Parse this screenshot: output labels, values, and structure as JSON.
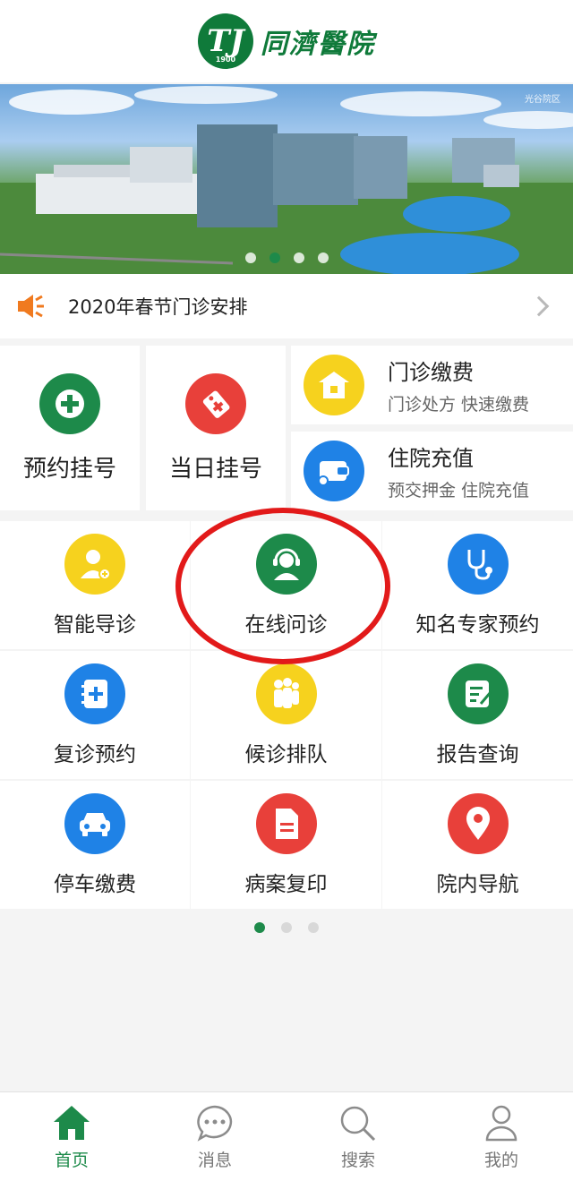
{
  "header": {
    "logo_text": "同濟醫院",
    "logo_mark": "TJ",
    "logo_year": "1900"
  },
  "banner": {
    "caption": "光谷院区",
    "slide_count": 4,
    "active_slide": 2
  },
  "notice": {
    "text": "2020年春节门诊安排",
    "icon": "megaphone-icon"
  },
  "quick": {
    "appointment": {
      "label": "预约挂号",
      "icon": "plus-icon"
    },
    "same_day": {
      "label": "当日挂号",
      "icon": "tag-icon"
    },
    "outpatient_payment": {
      "title": "门诊缴费",
      "subtitle": "门诊处方 快速缴费",
      "icon": "house-icon"
    },
    "inpatient_recharge": {
      "title": "住院充值",
      "subtitle": "预交押金 住院充值",
      "icon": "wallet-icon"
    }
  },
  "grid": [
    {
      "name": "smart-guide",
      "label": "智能导诊",
      "icon": "doctor-icon",
      "color": "yellow"
    },
    {
      "name": "online-consult",
      "label": "在线问诊",
      "icon": "headset-icon",
      "color": "green"
    },
    {
      "name": "expert-appointment",
      "label": "知名专家预约",
      "icon": "stethoscope-icon",
      "color": "blue"
    },
    {
      "name": "follow-up",
      "label": "复诊预约",
      "icon": "notebook-plus-icon",
      "color": "blue"
    },
    {
      "name": "queue",
      "label": "候诊排队",
      "icon": "people-icon",
      "color": "yellow"
    },
    {
      "name": "report",
      "label": "报告查询",
      "icon": "report-icon",
      "color": "green"
    },
    {
      "name": "parking",
      "label": "停车缴费",
      "icon": "car-icon",
      "color": "blue"
    },
    {
      "name": "records-copy",
      "label": "病案复印",
      "icon": "document-icon",
      "color": "red"
    },
    {
      "name": "navigation",
      "label": "院内导航",
      "icon": "location-pin-icon",
      "color": "red"
    }
  ],
  "grid_pages": {
    "count": 3,
    "active": 1
  },
  "tabbar": [
    {
      "label": "首页",
      "icon": "home-icon",
      "active": true
    },
    {
      "label": "消息",
      "icon": "chat-icon",
      "active": false
    },
    {
      "label": "搜索",
      "icon": "search-icon",
      "active": false
    },
    {
      "label": "我的",
      "icon": "user-icon",
      "active": false
    }
  ],
  "colors": {
    "brand_green": "#1d8a4a",
    "red": "#e8403a",
    "yellow": "#f6d21e",
    "blue": "#1f82e6",
    "highlight": "#e21a1a"
  }
}
